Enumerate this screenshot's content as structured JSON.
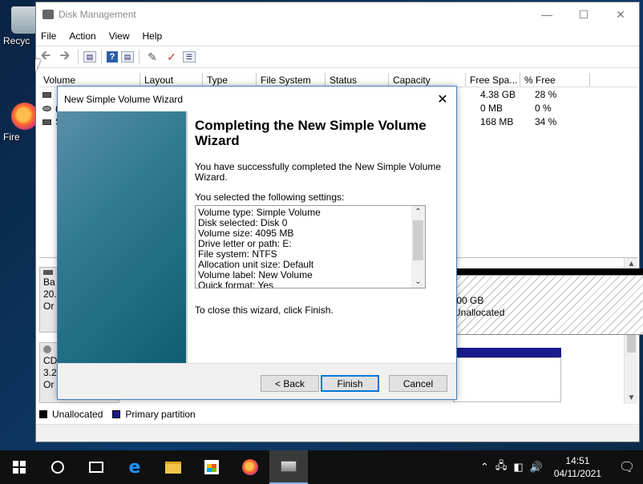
{
  "desktop": {
    "icons": [
      {
        "label": "Recyc"
      },
      {
        "label": "Fire"
      }
    ]
  },
  "disk_mgmt": {
    "title": "Disk Management",
    "menu": [
      "File",
      "Action",
      "View",
      "Help"
    ],
    "columns": [
      "Volume",
      "Layout",
      "Type",
      "File System",
      "Status",
      "Capacity",
      "Free Spa...",
      "% Free"
    ],
    "rows": [
      {
        "volume": "",
        "free": "4.38 GB",
        "pct": "28 %"
      },
      {
        "volume": "(",
        "free": "0 MB",
        "pct": "0 %"
      },
      {
        "volume": "S",
        "free": "168 MB",
        "pct": "34 %"
      }
    ],
    "disk0": {
      "line1": "Ba",
      "line2": "20.",
      "line3": "Or"
    },
    "cdrom": {
      "line1": "CD",
      "line2": "3.2",
      "line3": "Or"
    },
    "unallocated_block": {
      "size": ".00 GB",
      "label": "Unallocated"
    },
    "legend": [
      {
        "label": "Unallocated",
        "color": "#000000"
      },
      {
        "label": "Primary partition",
        "color": "#1a1a8c"
      }
    ]
  },
  "wizard": {
    "title": "New Simple Volume Wizard",
    "heading": "Completing the New Simple Volume Wizard",
    "success_text": "You have successfully completed the New Simple Volume Wizard.",
    "settings_label": "You selected the following settings:",
    "settings": [
      "Volume type: Simple Volume",
      "Disk selected: Disk 0",
      "Volume size: 4095 MB",
      "Drive letter or path: E:",
      "File system: NTFS",
      "Allocation unit size: Default",
      "Volume label: New Volume",
      "Quick format: Yes"
    ],
    "close_text": "To close this wizard, click Finish.",
    "buttons": {
      "back": "< Back",
      "finish": "Finish",
      "cancel": "Cancel"
    }
  },
  "taskbar": {
    "time": "14:51",
    "date": "04/11/2021"
  }
}
